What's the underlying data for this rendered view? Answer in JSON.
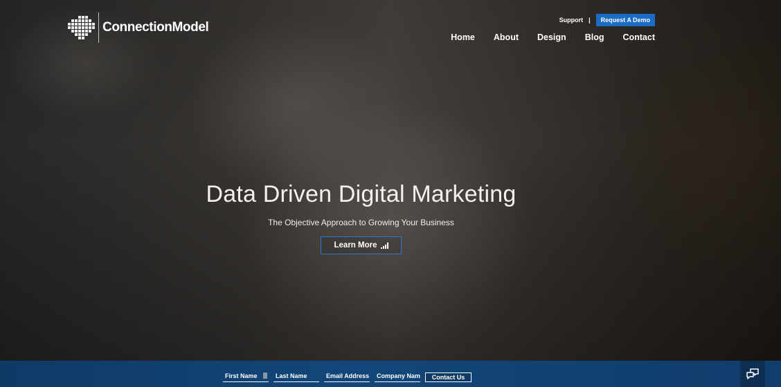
{
  "brand": {
    "logo_text": "ConnectionModel",
    "logo_icon": "dot-grid-logo-icon"
  },
  "utility": {
    "support_label": "Support",
    "separator": "|",
    "demo_label": "Request A Demo",
    "demo_color": "#1a6cc6"
  },
  "nav": {
    "items": [
      {
        "label": "Home"
      },
      {
        "label": "About"
      },
      {
        "label": "Design"
      },
      {
        "label": "Blog"
      },
      {
        "label": "Contact"
      }
    ]
  },
  "hero": {
    "title": "Data Driven Digital Marketing",
    "subtitle": "The Objective Approach to Growing Your Business",
    "cta_label": "Learn More",
    "cta_icon": "signal-bars-icon",
    "cta_border_color": "#2d78d0"
  },
  "form": {
    "fields": [
      {
        "placeholder": "First Name"
      },
      {
        "placeholder": "Last Name"
      },
      {
        "placeholder": "Email Address"
      },
      {
        "placeholder": "Company Nam"
      }
    ],
    "submit_label": "Contact Us",
    "bar_color": "#12467a"
  },
  "chat": {
    "icon": "chat-bubbles-icon"
  }
}
